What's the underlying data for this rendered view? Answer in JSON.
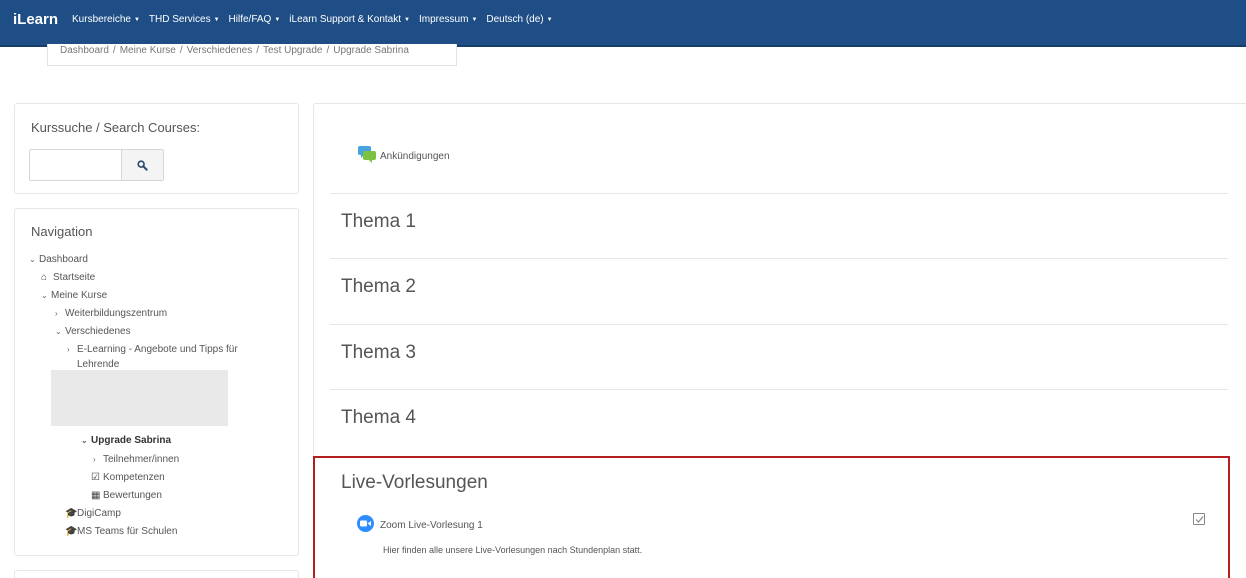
{
  "navbar": {
    "brand": "iLearn",
    "menu": [
      "Kursbereiche",
      "THD Services",
      "Hilfe/FAQ",
      "iLearn Support & Kontakt",
      "Impressum",
      "Deutsch (de)"
    ],
    "caret_icon": "caret-down-icon"
  },
  "breadcrumb": {
    "items": [
      "Dashboard",
      "Meine Kurse",
      "Verschiedenes",
      "Test Upgrade",
      "Upgrade Sabrina"
    ],
    "separator": "/"
  },
  "search_block": {
    "title": "Kurssuche / Search Courses:",
    "input_value": "",
    "button_icon": "search-icon"
  },
  "navigation": {
    "title": "Navigation",
    "items": [
      {
        "label": "Dashboard",
        "icon": "chevron-down-icon"
      },
      {
        "label": "Startseite",
        "icon": "home-icon"
      },
      {
        "label": "Meine Kurse",
        "icon": "chevron-down-icon"
      },
      {
        "label": "Weiterbildungszentrum",
        "icon": "chevron-right-icon"
      },
      {
        "label": "Verschiedenes",
        "icon": "chevron-down-icon"
      },
      {
        "label": "E-Learning - Angebote und Tipps für",
        "icon": "chevron-right-icon"
      },
      {
        "label": "Lehrende",
        "icon": ""
      },
      {
        "label": "Upgrade Sabrina",
        "icon": "chevron-down-icon"
      },
      {
        "label": "Teilnehmer/innen",
        "icon": "chevron-right-icon"
      },
      {
        "label": "Kompetenzen",
        "icon": "check-square-icon"
      },
      {
        "label": "Bewertungen",
        "icon": "table-icon"
      },
      {
        "label": "DigiCamp",
        "icon": "graduation-cap-icon"
      },
      {
        "label": "MS Teams für Schulen",
        "icon": "graduation-cap-icon"
      }
    ]
  },
  "main": {
    "announcements": {
      "label": "Ankündigungen",
      "icon": "forum-icon"
    },
    "sections": [
      "Thema 1",
      "Thema 2",
      "Thema 3",
      "Thema 4"
    ],
    "live": {
      "title": "Live-Vorlesungen",
      "activity_label": "Zoom Live-Vorlesung 1",
      "activity_icon": "zoom-icon",
      "description": "Hier finden alle unsere Live-Vorlesungen nach Stundenplan statt.",
      "completion_icon": "completion-checkbox-icon"
    }
  },
  "colors": {
    "navbar": "#1f4e86",
    "highlight_border": "#b31f1f",
    "zoom": "#2d8cff"
  }
}
